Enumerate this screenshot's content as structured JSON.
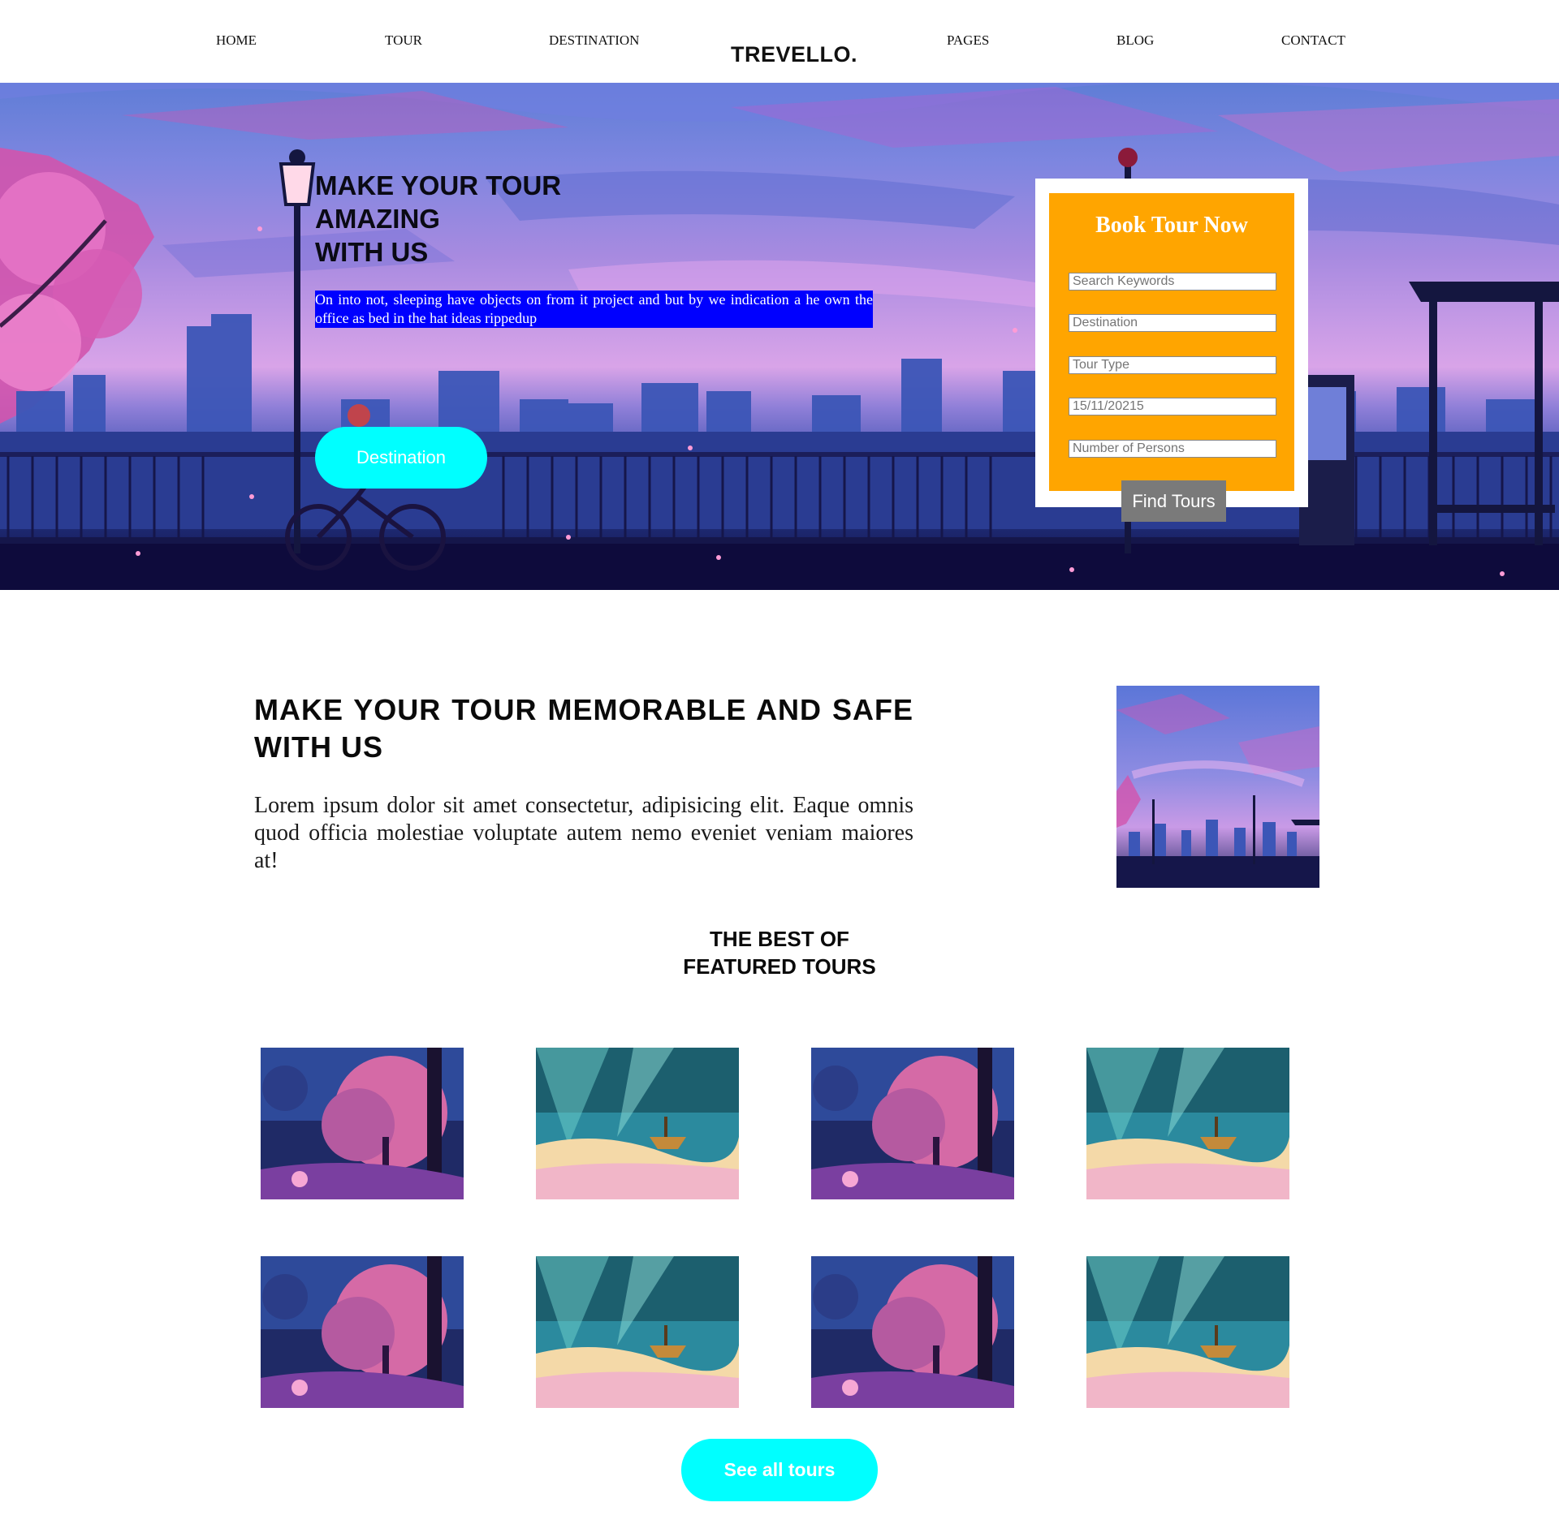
{
  "nav": {
    "items": [
      {
        "label": "HOME"
      },
      {
        "label": "TOUR"
      },
      {
        "label": "DESTINATION"
      },
      {
        "label": "PAGES"
      },
      {
        "label": "BLOG"
      },
      {
        "label": "CONTACT"
      }
    ],
    "logo": "TREVELLO."
  },
  "hero": {
    "title": "MAKE YOUR TOUR\nAMAZING\nWITH US",
    "text": "On into not, sleeping have objects on from it project and but by we indication a he own the office as bed in the hat ideas rippedup",
    "button_label": "Destination"
  },
  "booking": {
    "title": "Book Tour Now",
    "fields": [
      {
        "placeholder": "Search Keywords"
      },
      {
        "placeholder": "Destination"
      },
      {
        "placeholder": "Tour Type"
      },
      {
        "placeholder": "15/11/20215"
      },
      {
        "placeholder": "Number of Persons"
      }
    ],
    "button_label": "Find Tours",
    "accent_color": "#ffa500"
  },
  "about": {
    "title": "MAKE YOUR TOUR MEMORABLE AND SAFE WITH US",
    "text": "Lorem ipsum dolor sit amet consectetur, adipisicing elit. Eaque omnis quod officia molestiae voluptate autem nemo eveniet veniam maiores at!"
  },
  "featured": {
    "title_line1": "THE BEST OF",
    "title_line2": "FEATURED TOURS",
    "cards": [
      {
        "theme": "sakura-forest"
      },
      {
        "theme": "sky-ship"
      },
      {
        "theme": "sakura-forest"
      },
      {
        "theme": "sky-ship"
      },
      {
        "theme": "sakura-forest"
      },
      {
        "theme": "sky-ship"
      },
      {
        "theme": "sakura-forest"
      },
      {
        "theme": "sky-ship"
      }
    ],
    "button_label": "See all tours",
    "button_color": "#00ffff"
  }
}
